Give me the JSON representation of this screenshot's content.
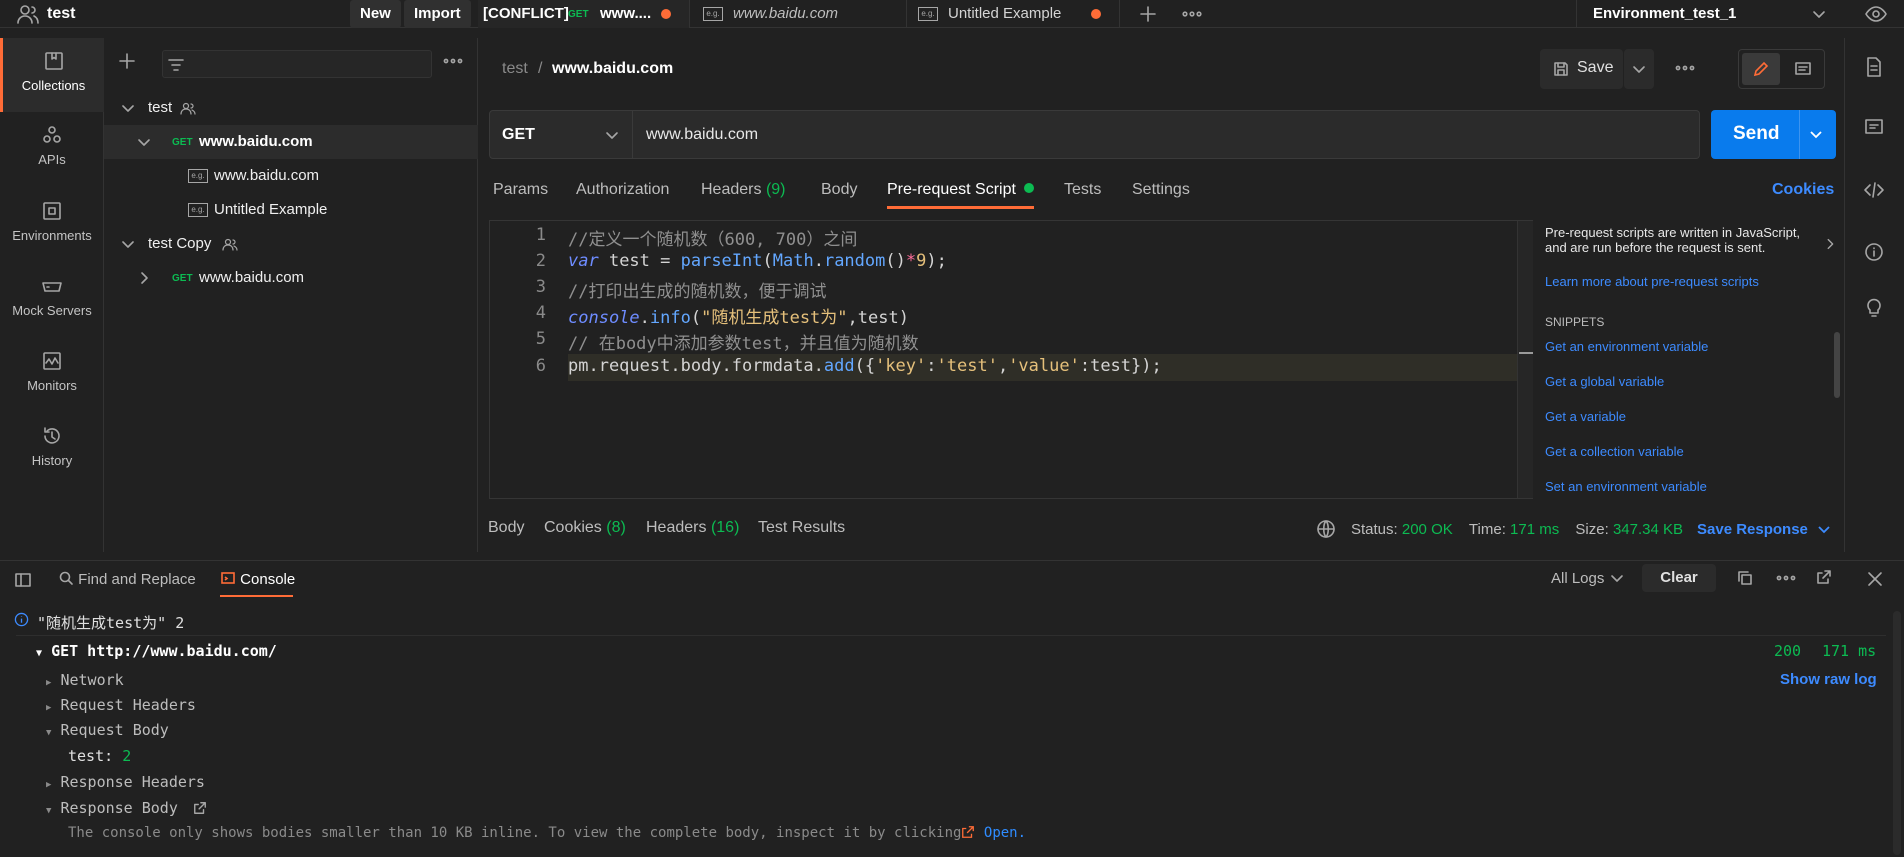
{
  "topbar": {
    "workspace": "test",
    "new_label": "New",
    "import_label": "Import",
    "tabs": [
      {
        "conflict": "[CONFLICT]",
        "method": "GET",
        "title": "www...."
      },
      {
        "title": "www.baidu.com"
      },
      {
        "title": "Untitled Example"
      }
    ],
    "environment": "Environment_test_1"
  },
  "leftnav": {
    "items": [
      {
        "label": "Collections",
        "icon": "collections-icon"
      },
      {
        "label": "APIs",
        "icon": "apis-icon"
      },
      {
        "label": "Environments",
        "icon": "environments-icon"
      },
      {
        "label": "Mock Servers",
        "icon": "mock-servers-icon"
      },
      {
        "label": "Monitors",
        "icon": "monitors-icon"
      },
      {
        "label": "History",
        "icon": "history-icon"
      }
    ]
  },
  "sidebar": {
    "tree": [
      {
        "label": "test"
      },
      {
        "method": "GET",
        "label": "www.baidu.com"
      },
      {
        "label": "www.baidu.com"
      },
      {
        "label": "Untitled Example"
      },
      {
        "label": "test Copy"
      },
      {
        "method": "GET",
        "label": "www.baidu.com"
      }
    ]
  },
  "request": {
    "breadcrumb_parent": "test",
    "breadcrumb_sep": "/",
    "breadcrumb_current": "www.baidu.com",
    "save_label": "Save",
    "method": "GET",
    "url": "www.baidu.com",
    "send_label": "Send",
    "tabs": {
      "params": "Params",
      "authorization": "Authorization",
      "headers": "Headers",
      "headers_count": "(9)",
      "body": "Body",
      "prerequest": "Pre-request Script",
      "tests": "Tests",
      "settings": "Settings"
    },
    "cookies_label": "Cookies"
  },
  "editor": {
    "line_numbers": [
      "1",
      "2",
      "3",
      "4",
      "5",
      "6"
    ],
    "lines": {
      "l1": "//定义一个随机数（600, 700）之间",
      "l2_kw": "var",
      "l2_rest": " test = ",
      "l2_fn": "parseInt",
      "l2_open": "(",
      "l2_obj": "Math",
      "l2_dot": ".",
      "l2_fn2": "random",
      "l2_paren": "()",
      "l2_op": "*",
      "l2_num": "9",
      "l2_end": ");",
      "l3": "//打印出生成的随机数，便于调试",
      "l4_obj": "console",
      "l4_dot": ".",
      "l4_fn": "info",
      "l4_open": "(",
      "l4_str": "\"随机生成test为\"",
      "l4_end": ",test)",
      "l5": "// 在body中添加参数test，并且值为随机数",
      "l6_a": "pm.request.body.formdata.",
      "l6_fn": "add",
      "l6_b": "({",
      "l6_k1": "'key'",
      "l6_c1": ":",
      "l6_v1": "'test'",
      "l6_c2": ",",
      "l6_k2": "'value'",
      "l6_c3": ":test});"
    }
  },
  "snippets": {
    "intro": "Pre-request scripts are written in JavaScript, and are run before the request is sent.",
    "learn_more": "Learn more about pre-request scripts",
    "heading": "SNIPPETS",
    "items": [
      "Get an environment variable",
      "Get a global variable",
      "Get a variable",
      "Get a collection variable",
      "Set an environment variable"
    ]
  },
  "response_bar": {
    "body": "Body",
    "cookies": "Cookies",
    "cookies_count": "(8)",
    "headers": "Headers",
    "headers_count": "(16)",
    "test_results": "Test Results",
    "status_label": "Status:",
    "status_value": "200 OK",
    "time_label": "Time:",
    "time_value": "171 ms",
    "size_label": "Size:",
    "size_value": "347.34 KB",
    "save_response": "Save Response"
  },
  "console": {
    "find_replace": "Find and Replace",
    "console_tab": "Console",
    "all_logs": "All Logs",
    "clear": "Clear",
    "log_message": "\"随机生成test为\"  2",
    "request_line": "GET http://www.baidu.com/",
    "status_code": "200",
    "duration": "171 ms",
    "show_raw": "Show raw log",
    "network": "Network",
    "request_headers": "Request Headers",
    "request_body": "Request Body",
    "body_key": "test:",
    "body_value": "2",
    "response_headers": "Response Headers",
    "response_body": "Response Body",
    "note": "The console only shows bodies smaller than 10 KB inline. To view the complete body, inspect it by clicking",
    "open": "Open."
  },
  "colors": {
    "accent": "#ff6c37",
    "send": "#097bed",
    "link": "#3d8bff",
    "success": "#0cbb52"
  }
}
